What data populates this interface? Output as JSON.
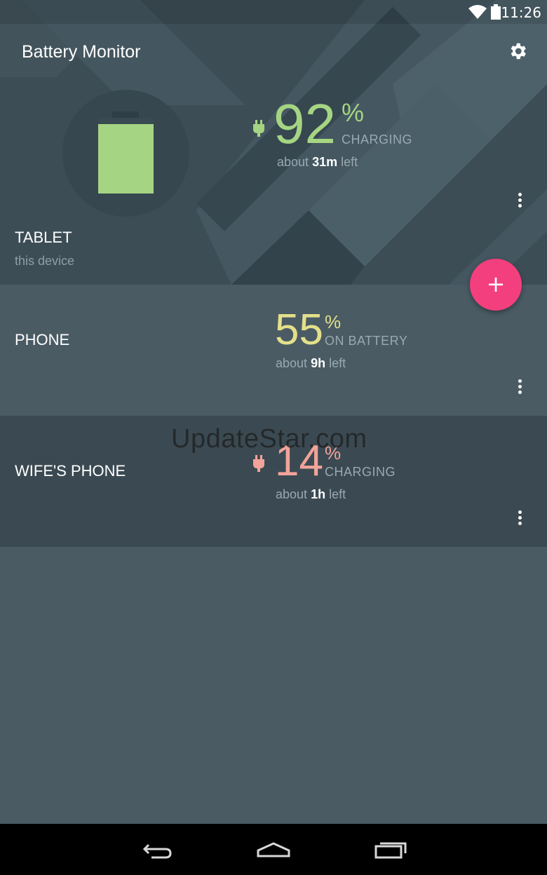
{
  "status": {
    "time": "11:26"
  },
  "app": {
    "title": "Battery Monitor"
  },
  "colors": {
    "charging_green": "#a5d582",
    "battery_yellow": "#e3e08a",
    "low_pink": "#f2a39a",
    "fab_pink": "#f33f7d"
  },
  "devices": [
    {
      "name": "TABLET",
      "subtitle": "this device",
      "percent": "92",
      "percent_sign": "%",
      "percent_value": 0.92,
      "state": "CHARGING",
      "eta_prefix": "about",
      "eta_value": "31m",
      "eta_suffix": "left",
      "charging": true
    },
    {
      "name": "PHONE",
      "percent": "55",
      "percent_sign": "%",
      "state": "ON BATTERY",
      "eta_prefix": "about",
      "eta_value": "9h",
      "eta_suffix": "left",
      "charging": false
    },
    {
      "name": "WIFE'S PHONE",
      "percent": "14",
      "percent_sign": "%",
      "state": "CHARGING",
      "eta_prefix": "about",
      "eta_value": "1h",
      "eta_suffix": "left",
      "charging": true
    }
  ],
  "fab": {
    "label": "+"
  },
  "watermark": "UpdateStar.com",
  "icons": {
    "settings": "gear-icon",
    "overflow": "more-vert-icon",
    "plug": "plug-icon",
    "wifi": "wifi-icon",
    "battery": "battery-icon",
    "back": "back-icon",
    "home": "home-icon",
    "recents": "recents-icon"
  }
}
